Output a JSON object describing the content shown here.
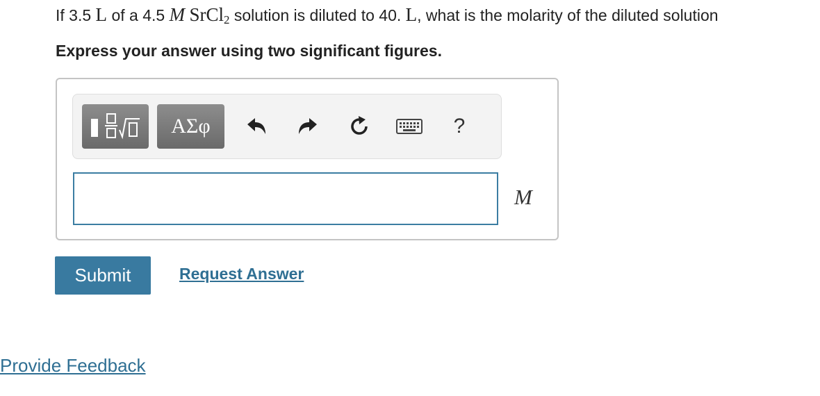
{
  "question": {
    "prefix": "If 3.5",
    "unit_l": "L",
    "of_a": "of a 4.5",
    "molar_symbol": "M",
    "compound_base": "SrCl",
    "compound_sub": "2",
    "middle": "solution is diluted to 40.",
    "suffix": ", what is the molarity of the diluted solution"
  },
  "instruction": "Express your answer using two significant figures.",
  "toolbar": {
    "symbols_label": "ΑΣφ",
    "help_label": "?"
  },
  "answer": {
    "value": "",
    "unit": "M"
  },
  "buttons": {
    "submit": "Submit",
    "request_answer": "Request Answer",
    "provide_feedback": "Provide Feedback"
  },
  "colors": {
    "accent": "#397aa0",
    "link": "#2f6f93",
    "toolbar_button": "#7a7a7a"
  }
}
